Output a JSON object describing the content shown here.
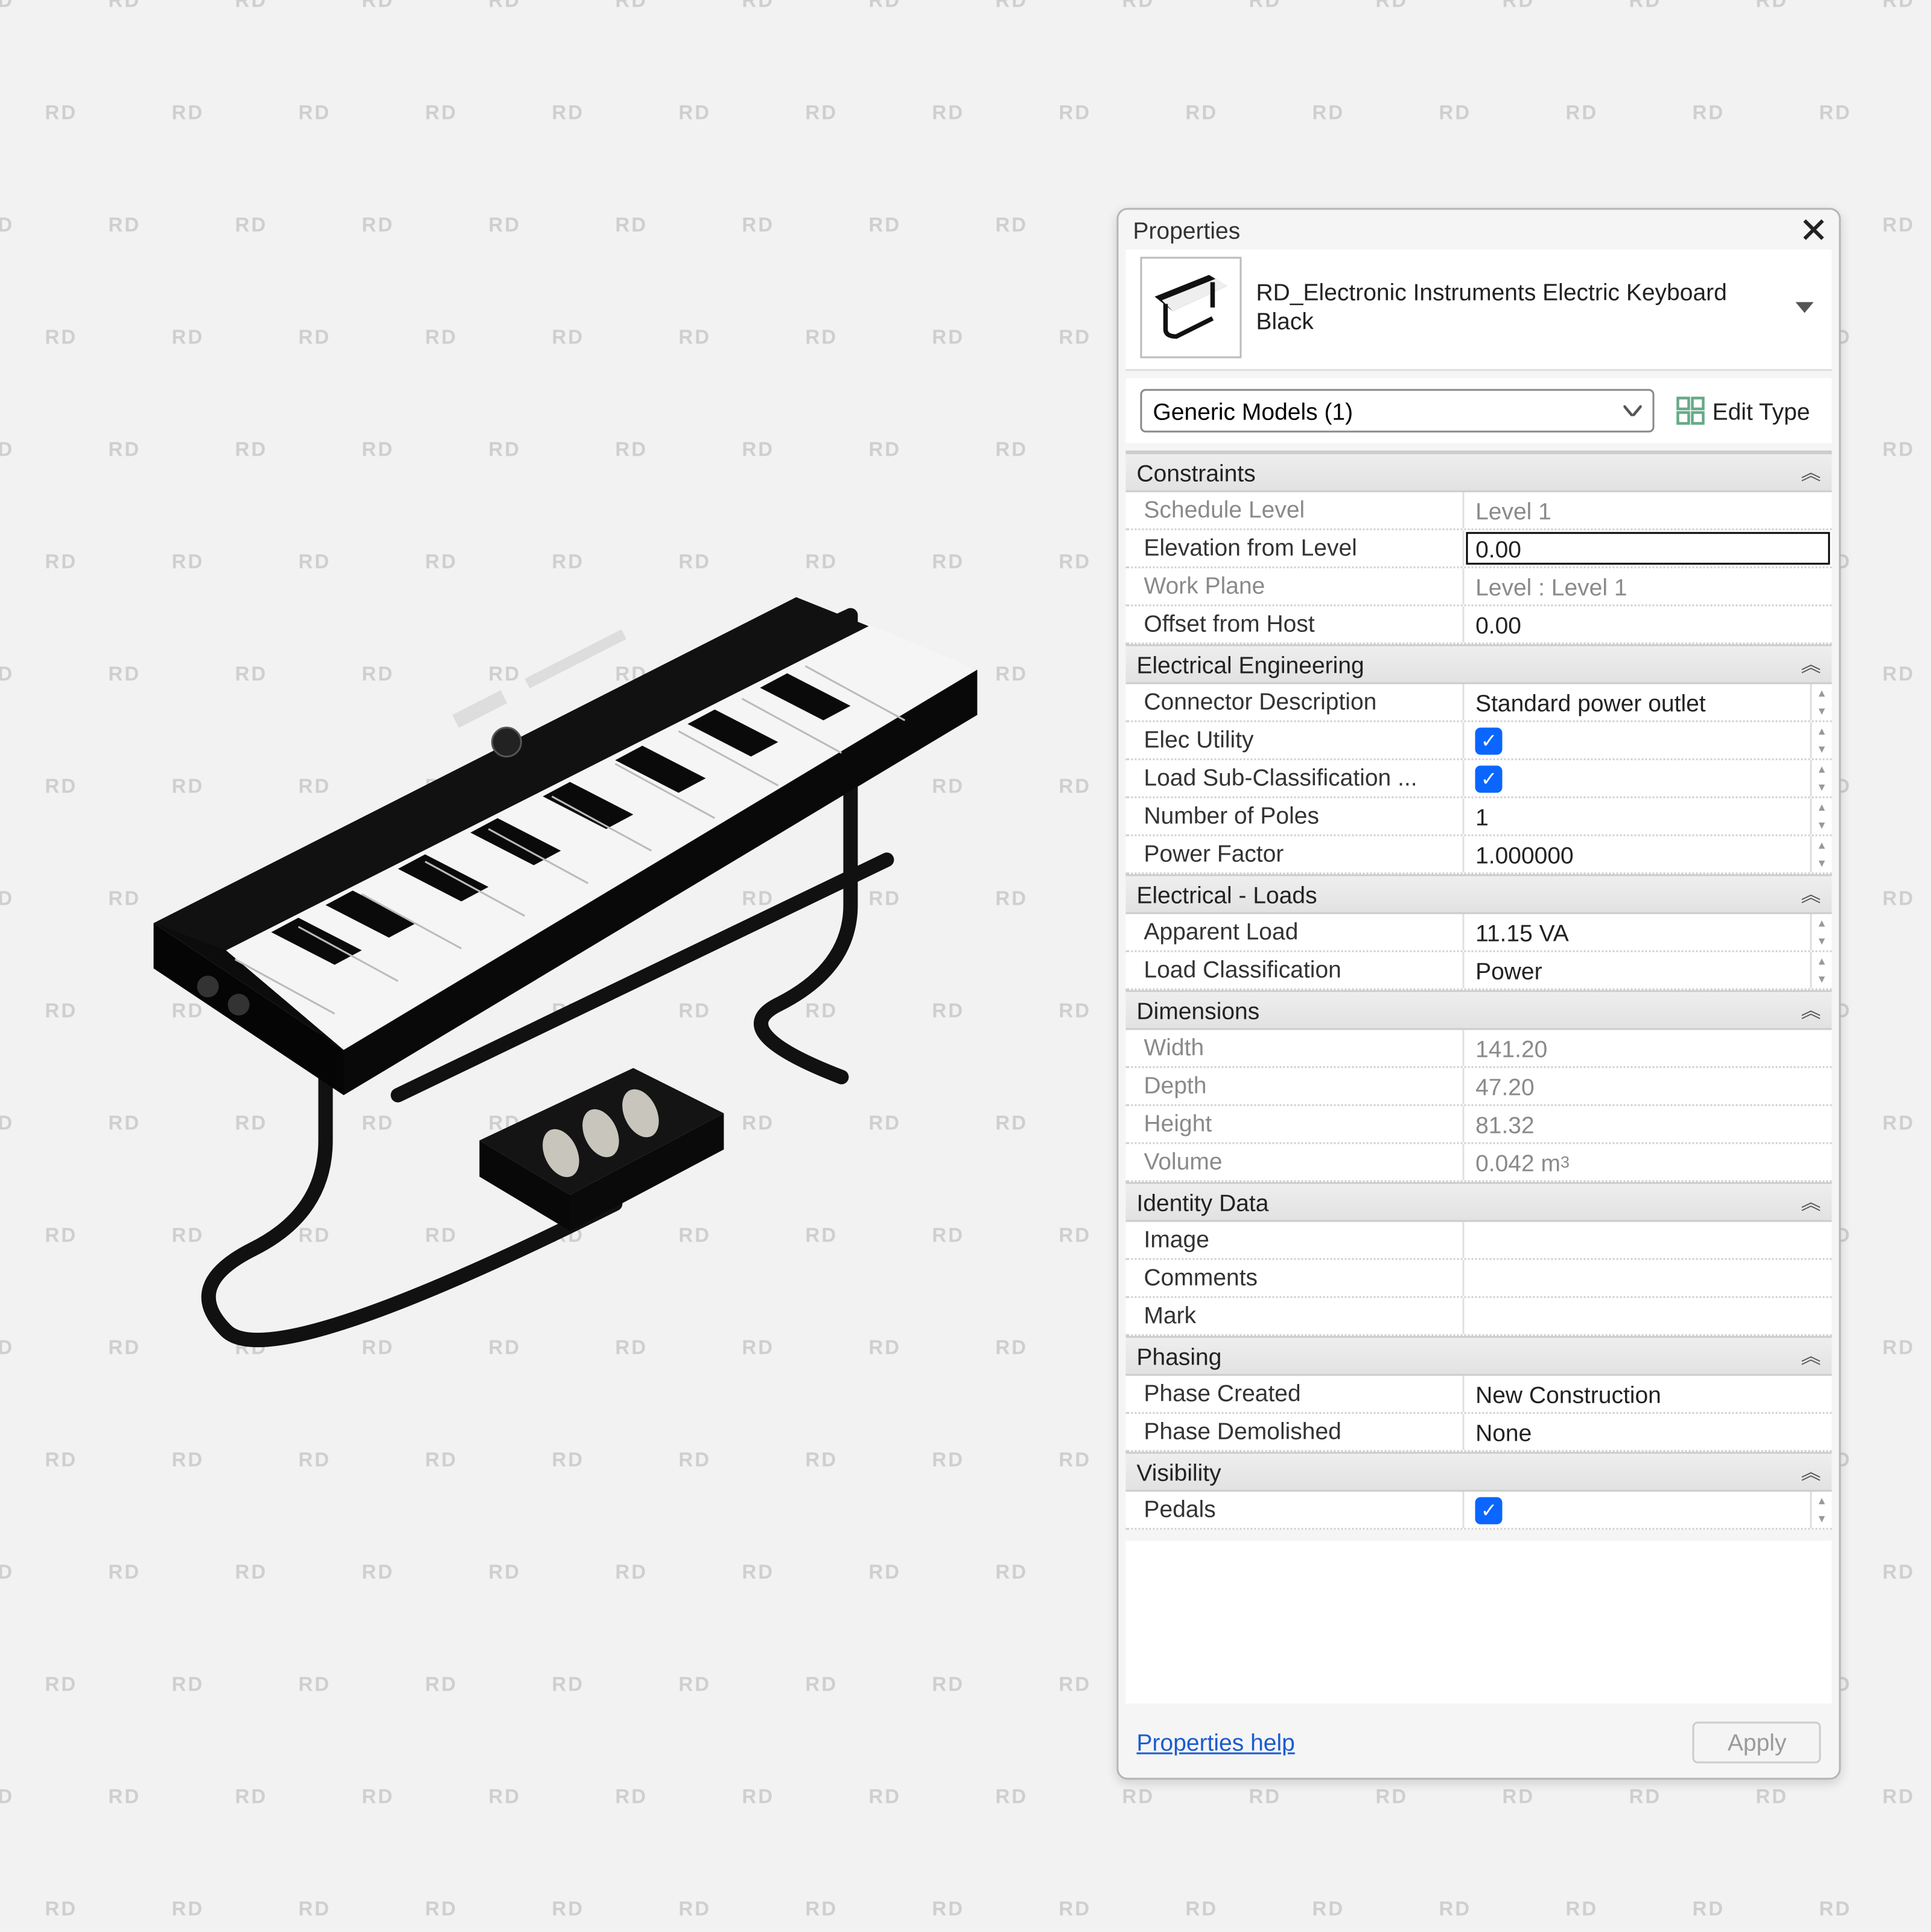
{
  "watermark_text": "RD",
  "panel": {
    "title": "Properties",
    "family_name": "RD_Electronic Instruments Electric Keyboard",
    "family_type": "Black",
    "selector": "Generic Models (1)",
    "edit_type_label": "Edit Type",
    "help_label": "Properties help",
    "apply_label": "Apply"
  },
  "groups": [
    {
      "title": "Constraints",
      "rows": [
        {
          "label": "Schedule Level",
          "value": "Level 1",
          "readonly": true
        },
        {
          "label": "Elevation from Level",
          "value": "0.00",
          "editable": true
        },
        {
          "label": "Work Plane",
          "value": "Level : Level 1",
          "readonly": true
        },
        {
          "label": "Offset from Host",
          "value": "0.00"
        }
      ]
    },
    {
      "title": "Electrical Engineering",
      "rows": [
        {
          "label": "Connector Description",
          "value": "Standard power outlet",
          "spin": true
        },
        {
          "label": "Elec Utility",
          "checkbox": true,
          "spin": true
        },
        {
          "label": "Load Sub-Classification ...",
          "checkbox": true,
          "spin": true
        },
        {
          "label": "Number of Poles",
          "value": "1",
          "spin": true
        },
        {
          "label": "Power Factor",
          "value": "1.000000",
          "spin": true
        }
      ]
    },
    {
      "title": "Electrical - Loads",
      "rows": [
        {
          "label": "Apparent Load",
          "value": "11.15 VA",
          "spin": true
        },
        {
          "label": "Load Classification",
          "value": "Power",
          "spin": true
        }
      ]
    },
    {
      "title": "Dimensions",
      "rows": [
        {
          "label": "Width",
          "value": "141.20",
          "readonly": true
        },
        {
          "label": "Depth",
          "value": "47.20",
          "readonly": true
        },
        {
          "label": "Height",
          "value": "81.32",
          "readonly": true
        },
        {
          "label": "Volume",
          "value_html": "0.042 m<sup>3</sup>",
          "readonly": true
        }
      ]
    },
    {
      "title": "Identity Data",
      "rows": [
        {
          "label": "Image",
          "value": ""
        },
        {
          "label": "Comments",
          "value": ""
        },
        {
          "label": "Mark",
          "value": ""
        }
      ]
    },
    {
      "title": "Phasing",
      "rows": [
        {
          "label": "Phase Created",
          "value": "New Construction"
        },
        {
          "label": "Phase Demolished",
          "value": "None"
        }
      ]
    },
    {
      "title": "Visibility",
      "rows": [
        {
          "label": "Pedals",
          "checkbox": true,
          "spin": true
        }
      ]
    }
  ]
}
